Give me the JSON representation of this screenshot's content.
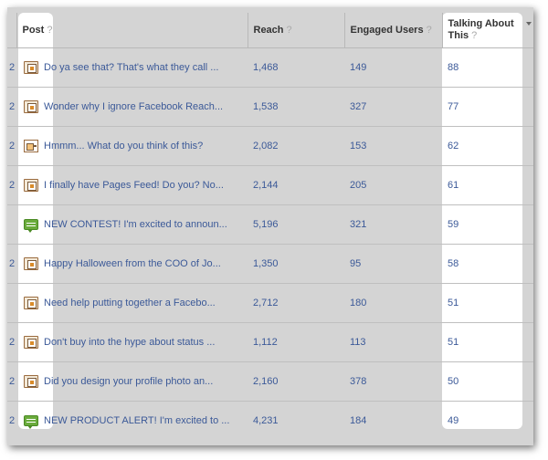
{
  "table": {
    "columns": {
      "post": "Post",
      "reach": "Reach",
      "engaged": "Engaged Users",
      "talking": "Talking About This",
      "help": "?"
    },
    "rows": [
      {
        "num": "2",
        "icon": "photo-icon",
        "post": "Do ya see that? That's what they call ...",
        "reach": "1,468",
        "engaged": "149",
        "talking": "88"
      },
      {
        "num": "2",
        "icon": "photo-icon",
        "post": "Wonder why I ignore Facebook Reach...",
        "reach": "1,538",
        "engaged": "327",
        "talking": "77"
      },
      {
        "num": "2",
        "icon": "link-icon",
        "post": "Hmmm... What do you think of this?",
        "reach": "2,082",
        "engaged": "153",
        "talking": "62"
      },
      {
        "num": "2",
        "icon": "photo-icon",
        "post": "I finally have Pages Feed! Do you? No...",
        "reach": "2,144",
        "engaged": "205",
        "talking": "61"
      },
      {
        "num": "",
        "icon": "status-icon",
        "post": "NEW CONTEST! I'm excited to announ...",
        "reach": "5,196",
        "engaged": "321",
        "talking": "59"
      },
      {
        "num": "2",
        "icon": "photo-icon",
        "post": "Happy Halloween from the COO of Jo...",
        "reach": "1,350",
        "engaged": "95",
        "talking": "58"
      },
      {
        "num": "",
        "icon": "photo-icon",
        "post": "Need help putting together a Facebo...",
        "reach": "2,712",
        "engaged": "180",
        "talking": "51"
      },
      {
        "num": "2",
        "icon": "photo-icon",
        "post": "Don't buy into the hype about status ...",
        "reach": "1,112",
        "engaged": "113",
        "talking": "51"
      },
      {
        "num": "2",
        "icon": "photo-icon",
        "post": "Did you design your profile photo an...",
        "reach": "2,160",
        "engaged": "378",
        "talking": "50"
      },
      {
        "num": "2",
        "icon": "status-icon",
        "post": "NEW PRODUCT ALERT! I'm excited to ...",
        "reach": "4,231",
        "engaged": "184",
        "talking": "49"
      }
    ]
  },
  "colors": {
    "link": "#3b5998",
    "background": "#d4d4d4",
    "highlight": "#ffffff"
  }
}
